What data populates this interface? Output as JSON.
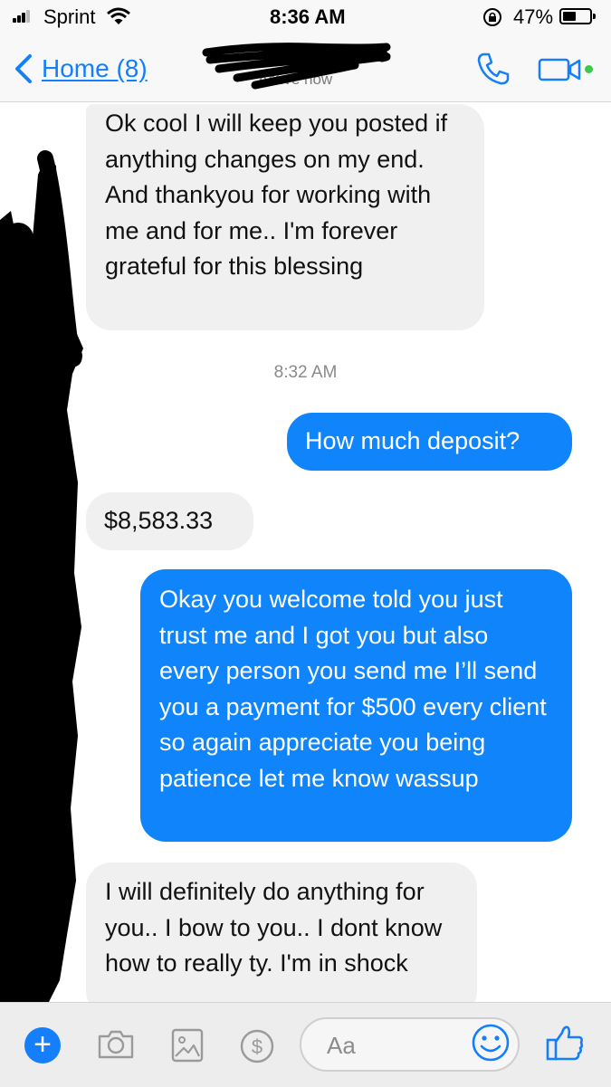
{
  "status_bar": {
    "carrier": "Sprint",
    "time": "8:36 AM",
    "battery": "47%",
    "battery_level": 0.47,
    "icons": [
      "signal-icon",
      "wifi-icon",
      "orientation-lock-icon",
      "battery-icon"
    ]
  },
  "nav": {
    "back_label": "Home (8)",
    "contact_status": "Active now",
    "icons": [
      "chevron-left-icon",
      "phone-icon",
      "video-camera-icon"
    ]
  },
  "messages": [
    {
      "direction": "incoming",
      "text": "Ok cool I will keep you posted if anything changes on my end. And thankyou for working with me and for me.. I'm forever grateful for this blessing"
    },
    {
      "direction": "timestamp",
      "text": "8:32 AM"
    },
    {
      "direction": "outgoing",
      "text": "How much deposit?"
    },
    {
      "direction": "incoming",
      "text": "$8,583.33"
    },
    {
      "direction": "outgoing",
      "text": "Okay you welcome told you just trust me and I got you but also every person you send me I’ll send you a payment for $500 every client so again appreciate you being patience let me know wassup"
    },
    {
      "direction": "incoming",
      "text": "I will definitely do anything for you.. I bow to you.. I dont know how to really ty. I'm in shock"
    }
  ],
  "composer": {
    "placeholder": "Aa",
    "icons": [
      "plus-icon",
      "camera-icon",
      "image-icon",
      "dollar-icon",
      "smiley-icon",
      "thumbs-up-icon"
    ]
  },
  "colors": {
    "accent": "#147efb",
    "outgoing_bubble": "#0f84fb",
    "incoming_bubble": "#f1f0f0",
    "active_dot": "#3fc94a"
  }
}
